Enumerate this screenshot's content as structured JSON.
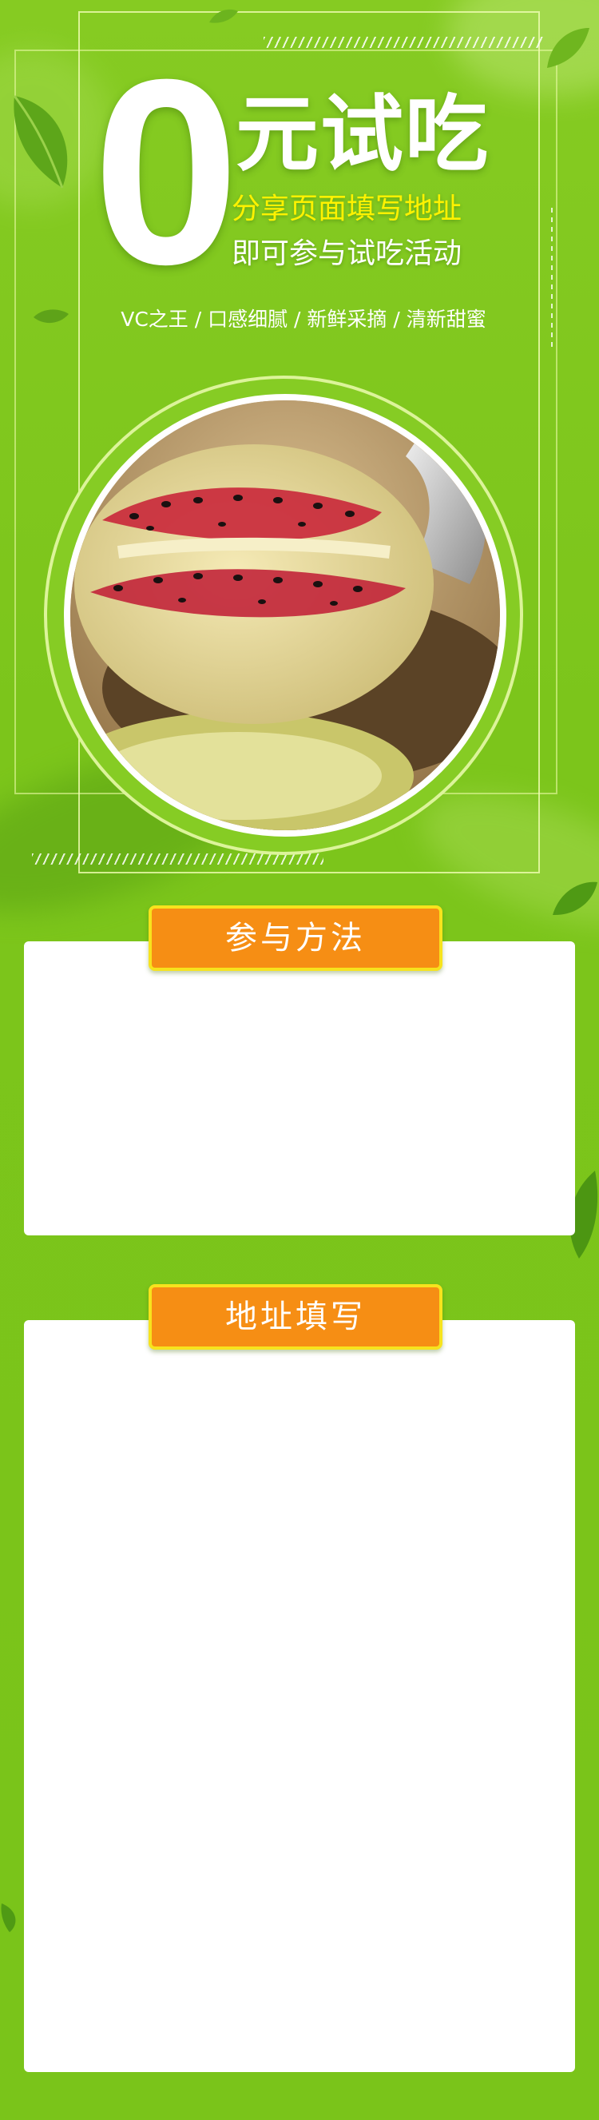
{
  "hero": {
    "big_number": "0",
    "title": "元试吃",
    "subtitle_line1": "分享页面填写地址",
    "subtitle_line2": "即可参与试吃活动",
    "tags": "VC之王 / 口感细腻 / 新鲜采摘 / 清新甜蜜",
    "image": "kiwi-fruit-on-spoon"
  },
  "sections": [
    {
      "title": "参与方法",
      "body": ""
    },
    {
      "title": "地址填写",
      "body": ""
    }
  ],
  "colors": {
    "background": "#7dc51c",
    "accent_yellow": "#fff200",
    "section_title_bg": "#f68e14",
    "section_title_border": "#f7e31d",
    "card": "#ffffff"
  },
  "icons": [
    "leaf-icon"
  ]
}
